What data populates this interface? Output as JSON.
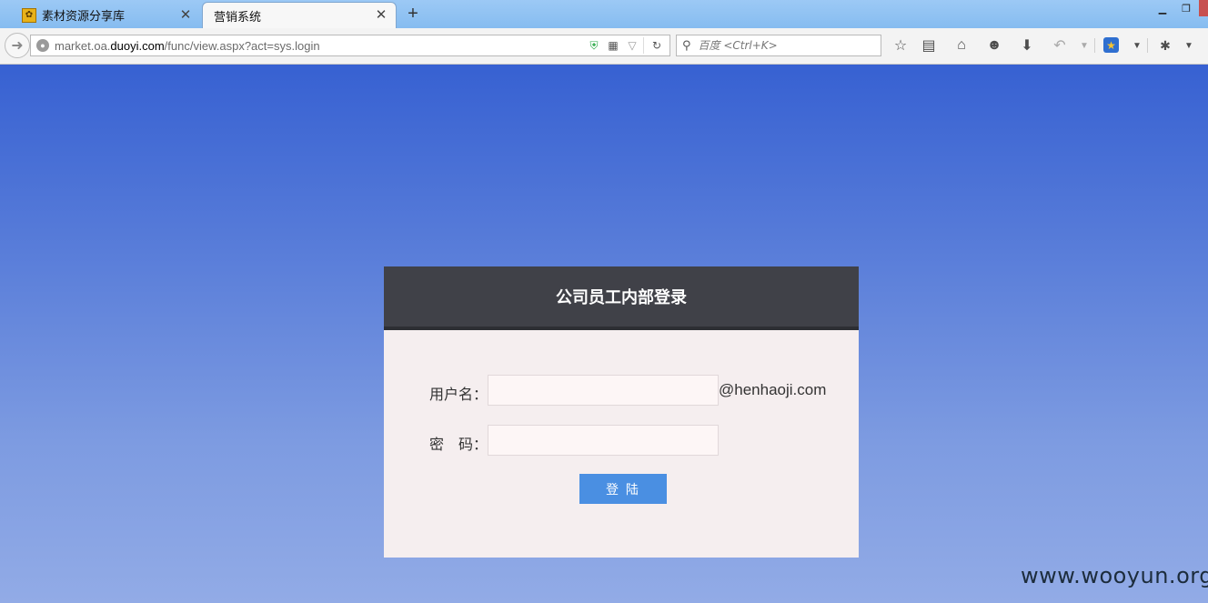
{
  "tabs": [
    {
      "title": "素材资源分享库",
      "icon": "site-favicon-icon",
      "active": false
    },
    {
      "title": "营销系统",
      "active": true
    }
  ],
  "address_bar": {
    "url_prefix": "market.oa.",
    "url_host": "duoyi.com",
    "url_path": "/func/view.aspx?act=sys.login"
  },
  "search_bar": {
    "placeholder": "百度 <Ctrl+K>"
  },
  "login": {
    "title": "公司员工内部登录",
    "username_label": "用户名：",
    "username_suffix": "@henhaoji.com",
    "password_label": "密　码：",
    "submit_label": "登 陆"
  },
  "watermark": "www.wooyun.org",
  "colors": {
    "header_bg": "#404148",
    "button_bg": "#4a8fe2",
    "page_gradient_top": "#3761d2",
    "page_gradient_bottom": "#92abe6"
  }
}
